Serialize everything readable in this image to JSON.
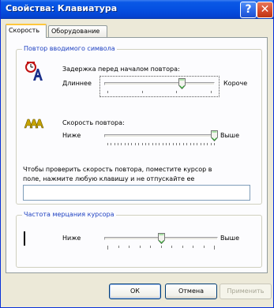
{
  "window": {
    "title": "Свойства: Клавиатура"
  },
  "titlebar": {
    "help_glyph": "?",
    "close_glyph": "✕"
  },
  "tabs": [
    {
      "label": "Скорость",
      "active": true
    },
    {
      "label": "Оборудование",
      "active": false
    }
  ],
  "repeat_group": {
    "label": "Повтор вводимого символа",
    "delay": {
      "label": "Задержка перед началом повтора:",
      "left": "Длиннее",
      "right": "Короче",
      "value_fraction": 0.72
    },
    "rate": {
      "label": "Скорость повтора:",
      "left": "Ниже",
      "right": "Выше",
      "value_fraction": 1.0
    },
    "test_hint_line1": "Чтобы проверить скорость повтора, поместите курсор в",
    "test_hint_line2": "поле, нажмите любую клавишу и не отпускайте ее",
    "test_value": ""
  },
  "cursor_group": {
    "label": "Частота мерцания курсора",
    "left": "Ниже",
    "right": "Выше",
    "value_fraction": 0.5
  },
  "buttons": {
    "ok": "ОК",
    "cancel": "Отмена",
    "apply": "Применить"
  },
  "colors": {
    "title_bar": "#0550e1",
    "group_label": "#1c3fc1",
    "active_tab_accent": "#ffc73c"
  }
}
